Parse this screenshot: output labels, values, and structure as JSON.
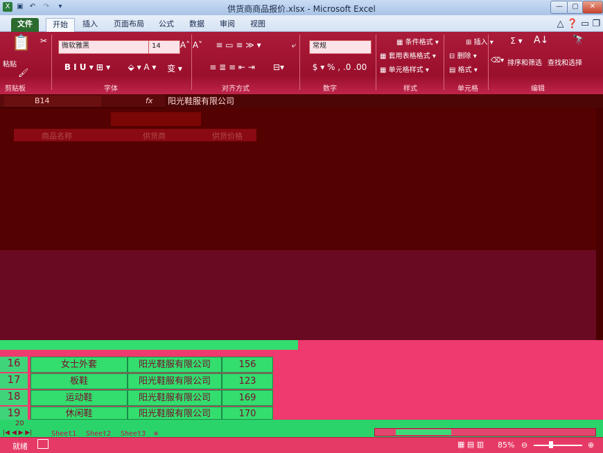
{
  "window": {
    "title": "供货商商品报价.xlsx - Microsoft Excel",
    "controls": [
      "—",
      "▢",
      "✕"
    ]
  },
  "tabs": [
    {
      "label": "文件"
    },
    {
      "label": "开始"
    },
    {
      "label": "插入"
    },
    {
      "label": "页面布局"
    },
    {
      "label": "公式"
    },
    {
      "label": "数据"
    },
    {
      "label": "审阅"
    },
    {
      "label": "视图"
    }
  ],
  "ribbon": {
    "paste": "粘贴",
    "font_name": "微软雅黑",
    "font_size": "14",
    "number_format": "常规",
    "cond_format": "条件格式",
    "table_format": "套用表格格式",
    "cell_style": "单元格样式",
    "insert": "插入",
    "delete": "删除",
    "format": "格式",
    "sort_filter": "排序和筛选",
    "find_select": "查找和选择",
    "groups": [
      "剪贴板",
      "字体",
      "对齐方式",
      "数字",
      "样式",
      "单元格",
      "编辑"
    ]
  },
  "formula_bar": {
    "name_box": "B14",
    "fx": "fx",
    "value": "阳光鞋服有限公司"
  },
  "sheet": {
    "header_ghost": [
      "商品名称",
      "供货商",
      "供货价格"
    ],
    "rows": [
      {
        "row": "16",
        "name": "女士外套",
        "supplier": "阳光鞋服有限公司",
        "price": "156"
      },
      {
        "row": "17",
        "name": "板鞋",
        "supplier": "阳光鞋服有限公司",
        "price": "123"
      },
      {
        "row": "18",
        "name": "运动鞋",
        "supplier": "阳光鞋服有限公司",
        "price": "169"
      },
      {
        "row": "19",
        "name": "休闲鞋",
        "supplier": "阳光鞋服有限公司",
        "price": "170"
      }
    ],
    "partial_row": "20"
  },
  "sheet_tabs": [
    "Sheet1",
    "Sheet2",
    "Sheet3"
  ],
  "status": {
    "ready": "就绪",
    "zoom": "85%"
  }
}
